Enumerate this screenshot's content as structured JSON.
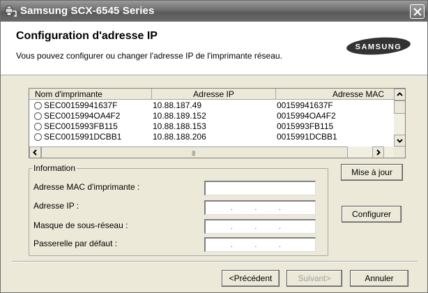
{
  "window": {
    "title": "Samsung SCX-6545 Series"
  },
  "header": {
    "title": "Configuration d'adresse IP",
    "subtitle": "Vous pouvez configurer ou changer l'adresse IP de l'imprimante réseau.",
    "logo_text": "SAMSUNG"
  },
  "list": {
    "columns": [
      "Nom d'imprimante",
      "Adresse IP",
      "Adresse MAC"
    ],
    "rows": [
      {
        "name": "SEC00159941637F",
        "ip": "10.88.187.49",
        "mac": "00159941637F"
      },
      {
        "name": "SEC0015994OA4F2",
        "ip": "10.88.189.152",
        "mac": "0015994OA4F2"
      },
      {
        "name": "SEC0015993FB115",
        "ip": "10.88.188.153",
        "mac": "0015993FB115"
      },
      {
        "name": "SEC0015991DCBB1",
        "ip": "10.88.188.206",
        "mac": "0015991DCBB1"
      }
    ]
  },
  "info": {
    "legend": "Information",
    "fields": [
      {
        "label": "Adresse MAC d'imprimante :",
        "value": ""
      },
      {
        "label": "Adresse IP :",
        "value": ".   .   ."
      },
      {
        "label": "Masque de sous-réseau :",
        "value": ".   .   ."
      },
      {
        "label": "Passerelle par défaut :",
        "value": ".   .   ."
      }
    ]
  },
  "buttons": {
    "refresh": "Mise à jour",
    "configure": "Configurer",
    "back": "<Précédent",
    "next": "Suivant>",
    "cancel": "Annuler"
  },
  "colors": {
    "dialog_bg": "#ece9d8",
    "titlebar": "#6e6e6e"
  },
  "icons": {
    "title": "printer-network-icon",
    "close": "close-icon"
  }
}
